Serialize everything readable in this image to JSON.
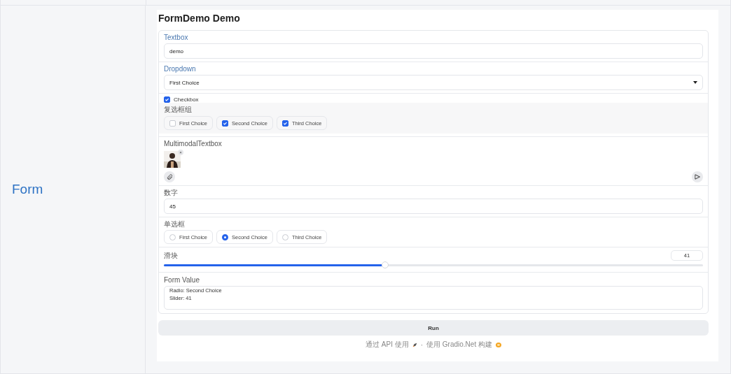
{
  "row_label": "Form",
  "demo": {
    "title": "FormDemo Demo",
    "textbox": {
      "label": "Textbox",
      "value": "demo"
    },
    "dropdown": {
      "label": "Dropdown",
      "value": "First Choice"
    },
    "checkbox": {
      "label": "Checkbox",
      "checked": true
    },
    "checkbox_group": {
      "label": "复选框组",
      "options": [
        {
          "label": "First Choice",
          "checked": false
        },
        {
          "label": "Second Choice",
          "checked": true
        },
        {
          "label": "Third Choice",
          "checked": true
        }
      ]
    },
    "multimodal": {
      "label": "MultimodalTextbox",
      "attachments": [
        {
          "kind": "picture",
          "remove": "×"
        }
      ]
    },
    "number": {
      "label": "数字",
      "value": "45"
    },
    "radio": {
      "label": "单选框",
      "options": [
        {
          "label": "First Choice",
          "selected": false
        },
        {
          "label": "Second Choice",
          "selected": true
        },
        {
          "label": "Third Choice",
          "selected": false
        }
      ]
    },
    "slider": {
      "label": "滑块",
      "value": "41",
      "level": 0.41
    },
    "form_value": {
      "label": "Form Value",
      "lines": [
        "Radio: Second Choice",
        "Slider: 41"
      ]
    },
    "run_button": "Run",
    "footer": {
      "api_link": "通过 API 使用",
      "separator": "·",
      "built_with": "使用 Gradio.Net 构建"
    }
  }
}
